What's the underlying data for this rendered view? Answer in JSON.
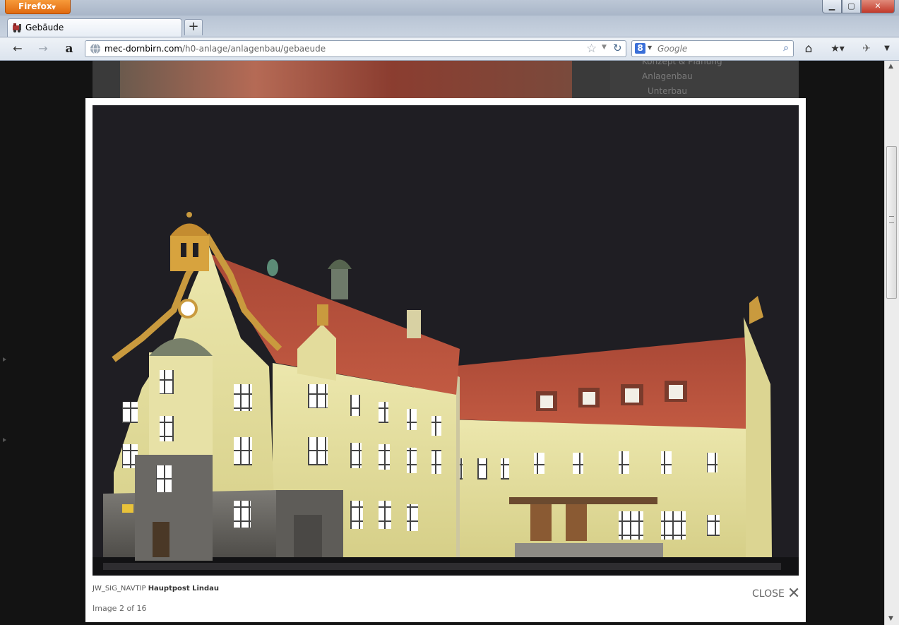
{
  "browser": {
    "app_name": "Firefox",
    "tab_title": "Gebäude",
    "url_host": "mec-dornbirn.com",
    "url_path": "/h0-anlage/anlagenbau/gebaeude",
    "search_placeholder": "Google",
    "search_engine_letter": "8"
  },
  "background_page": {
    "nav_items": [
      "Konzept & Planung",
      "Anlagenbau",
      "Unterbau"
    ]
  },
  "lightbox": {
    "caption_prefix": "JW_SIG_NAVTIP",
    "caption_title": "Hauptpost Lindau",
    "counter": "Image 2 of 16",
    "close_label": "CLOSE"
  },
  "colors": {
    "chrome_blue": "#bcc7d6",
    "firefox_orange": "#e8821f",
    "photo_bg": "#1f1e23",
    "facade": "#e6e0a2",
    "roof": "#b34a38",
    "stone": "#6e6c68",
    "ochre_trim": "#c99a3e"
  },
  "icons": {
    "back": "arrow-left-icon",
    "forward": "arrow-right-icon",
    "home": "home-icon",
    "bookmark": "star-icon",
    "reload": "reload-icon",
    "search": "magnifier-icon",
    "close": "close-icon"
  }
}
